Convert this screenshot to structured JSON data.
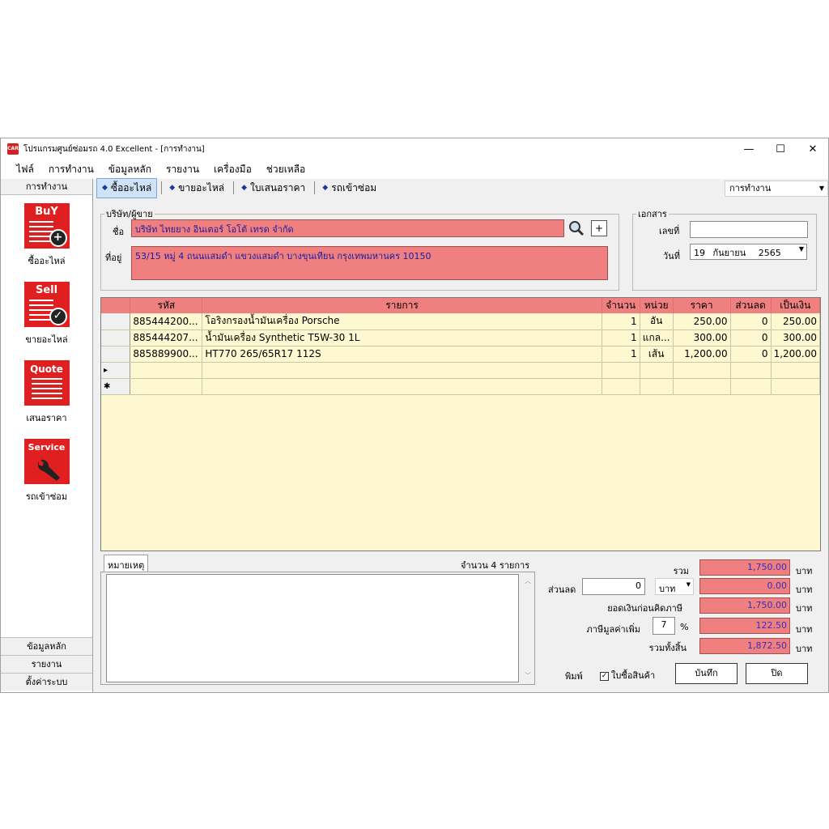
{
  "window": {
    "app_icon_text": "CAR",
    "title": "โปรแกรมศูนย์ซ่อมรถ 4.0 Excellent - [การทำงาน]",
    "minimize": "—",
    "maximize": "☐",
    "close": "✕"
  },
  "menu": [
    "ไฟล์",
    "การทำงาน",
    "ข้อมูลหลัก",
    "รายงาน",
    "เครื่องมือ",
    "ช่วยเหลือ"
  ],
  "sidebar": {
    "header": "การทำงาน",
    "items": [
      {
        "icon_text": "BuY",
        "icon": "buy-icon",
        "badge": "+",
        "label": "ซื้ออะไหล่"
      },
      {
        "icon_text": "Sell",
        "icon": "sell-icon",
        "badge": "✓",
        "label": "ขายอะไหล่"
      },
      {
        "icon_text": "Quote",
        "icon": "quote-icon",
        "badge": "",
        "label": "เสนอราคา"
      },
      {
        "icon_text": "Service",
        "icon": "service-wrench-icon",
        "badge": "🔧",
        "label": "รถเข้าซ่อม"
      }
    ],
    "bottom": [
      "ข้อมูลหลัก",
      "รายงาน",
      "ตั้งค่าระบบ"
    ]
  },
  "tabs": [
    {
      "label": "ซื้ออะไหล่",
      "active": true
    },
    {
      "label": "ขายอะไหล่",
      "active": false
    },
    {
      "label": "ใบเสนอราคา",
      "active": false
    },
    {
      "label": "รถเข้าซ่อม",
      "active": false
    }
  ],
  "view_combo": "การทำงาน",
  "vendor": {
    "group_label": "บริษัท/ผู้ขาย",
    "name_label": "ชื่อ",
    "name_value": "บริษัท ไทยยาง อินเตอร์ โอโต้ เทรด จำกัด",
    "address_label": "ที่อยู่",
    "address_value": "53/15 หมู่ 4 ถนนแสมดำ แขวงแสมดำ บางขุนเทียน กรุงเทพมหานคร 10150",
    "add_button": "+"
  },
  "document": {
    "group_label": "เอกสาร",
    "number_label": "เลขที่",
    "number_value": "",
    "date_label": "วันที่",
    "date_day": "19",
    "date_month": "กันยายน",
    "date_year": "2565"
  },
  "grid": {
    "columns": [
      "รหัส",
      "รายการ",
      "จำนวน",
      "หน่วย",
      "ราคา",
      "ส่วนลด",
      "เป็นเงิน"
    ],
    "rows": [
      {
        "code": "885444200...",
        "item": "โอริงกรองน้ำมันเครื่อง Porsche",
        "qty": "1",
        "unit": "อัน",
        "price": "250.00",
        "discount": "0",
        "amount": "250.00"
      },
      {
        "code": "885444207...",
        "item": "น้ำมันเครื่อง Synthetic T5W-30 1L",
        "qty": "1",
        "unit": "แกล...",
        "price": "300.00",
        "discount": "0",
        "amount": "300.00"
      },
      {
        "code": "885889900...",
        "item": "HT770 265/65R17 112S",
        "qty": "1",
        "unit": "เส้น",
        "price": "1,200.00",
        "discount": "0",
        "amount": "1,200.00"
      }
    ],
    "current_marker": "▸",
    "new_marker": "✱"
  },
  "notes": {
    "tab_label": "หมายเหตุ",
    "count_text": "จำนวน 4 รายการ"
  },
  "summary": {
    "total_label": "รวม",
    "total_value": "1,750.00",
    "discount_label": "ส่วนลด",
    "discount_input": "0",
    "discount_unit_select": "บาท",
    "discount_value": "0.00",
    "pre_vat_label": "ยอดเงินก่อนคิดภาษี",
    "pre_vat_value": "1,750.00",
    "vat_label": "ภาษีมูลค่าเพิ่ม",
    "vat_rate": "7",
    "vat_pct_sign": "%",
    "vat_value": "122.50",
    "grand_label": "รวมทั้งสิ้น",
    "grand_value": "1,872.50",
    "currency": "บาท"
  },
  "footer": {
    "print_label": "พิมพ์",
    "invoice_checkbox_label": "ใบซื้อสินค้า",
    "invoice_checked": true,
    "save_button": "บันทึก",
    "close_button": "ปิด"
  }
}
